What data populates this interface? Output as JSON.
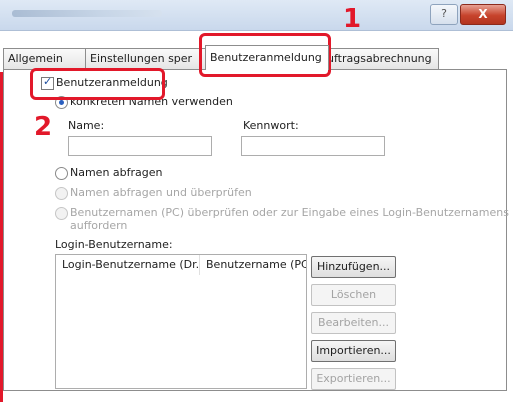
{
  "window": {
    "help_label": "?",
    "close_label": "X"
  },
  "tabs": [
    {
      "label": "Allgemein"
    },
    {
      "label": "Einstellungen sper"
    },
    {
      "label": "Benutzeranmeldung"
    },
    {
      "label": "uftragsabrechnung"
    }
  ],
  "user_login": {
    "checkbox_label": "Benutzeranmeldung",
    "checked": true,
    "option_specific_name": "konkreten Namen verwenden",
    "name_label": "Name:",
    "name_value": "",
    "password_label": "Kennwort:",
    "password_value": "",
    "option_prompt_name": "Namen abfragen",
    "option_prompt_verify": "Namen abfragen und überprüfen",
    "option_check_pc_line1": "Benutzernamen (PC) überprüfen oder zur Eingabe eines Login-Benutzernamens",
    "option_check_pc_line2": "auffordern"
  },
  "login_list": {
    "title": "Login-Benutzername:",
    "columns": [
      "Login-Benutzername (Dr...",
      "Benutzername (PC"
    ]
  },
  "buttons": {
    "add": "Hinzufügen...",
    "delete": "Löschen",
    "edit": "Bearbeiten...",
    "import": "Importieren...",
    "export": "Exportieren..."
  },
  "callouts": {
    "step1": "1",
    "step2": "2"
  },
  "colors": {
    "highlight": "#e2182a",
    "radio_selected": "#2a5fbf"
  }
}
